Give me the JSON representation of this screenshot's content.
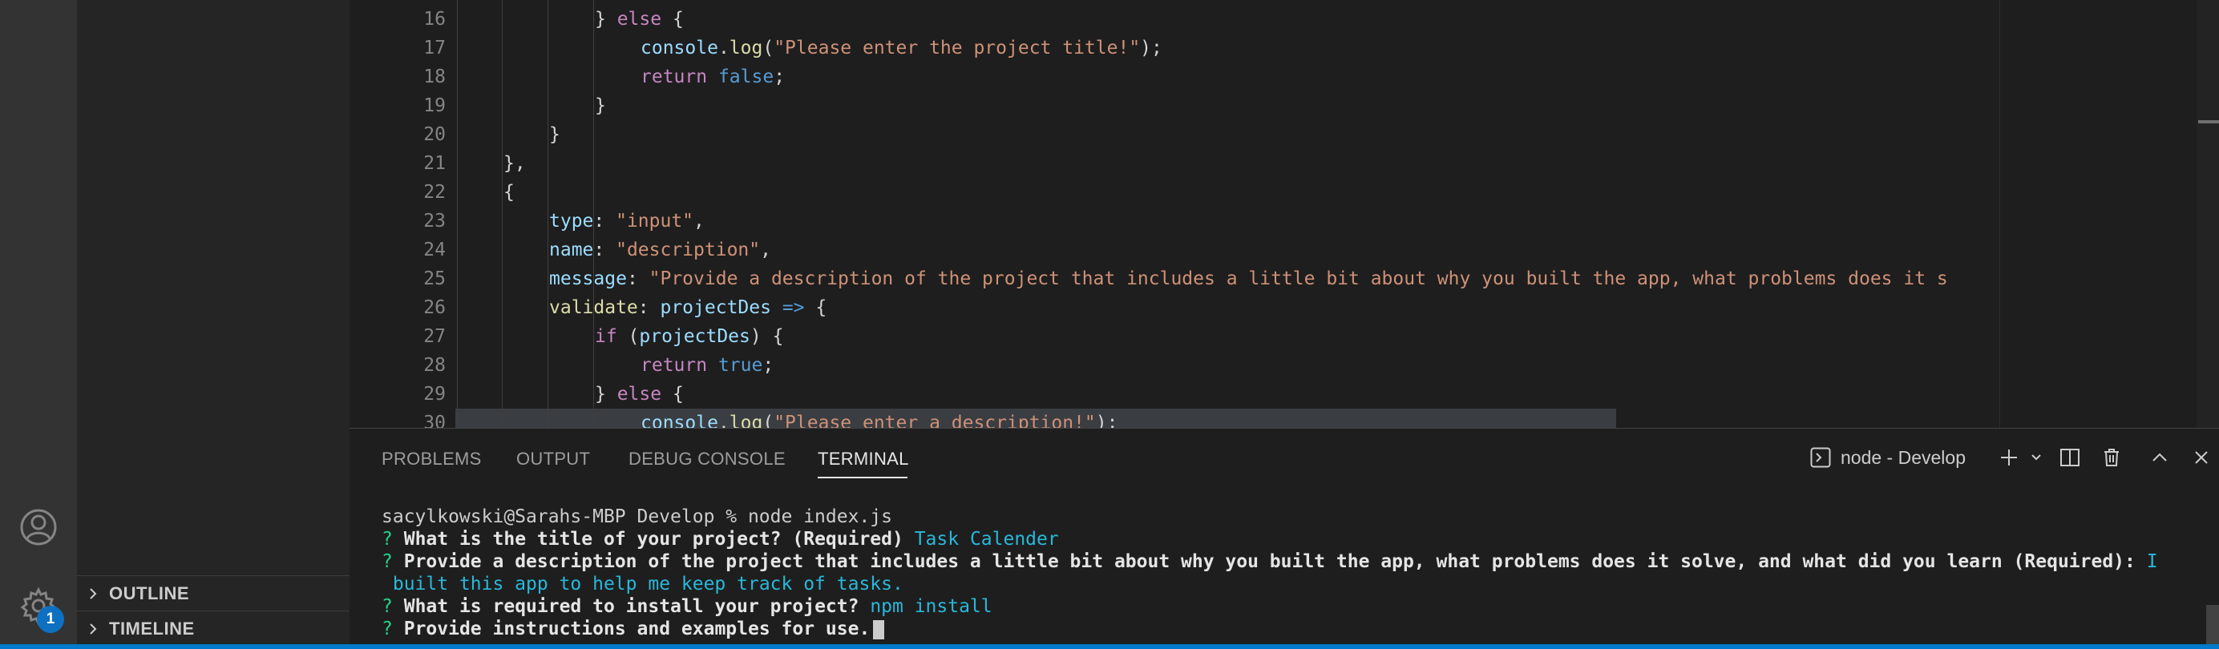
{
  "activity_bar": {
    "manage_badge": "1"
  },
  "side_bar": {
    "sections": [
      {
        "label": "OUTLINE"
      },
      {
        "label": "TIMELINE"
      }
    ]
  },
  "editor": {
    "lines": [
      {
        "n": "16"
      },
      {
        "n": "17"
      },
      {
        "n": "18"
      },
      {
        "n": "19"
      },
      {
        "n": "20"
      },
      {
        "n": "21"
      },
      {
        "n": "22"
      },
      {
        "n": "23"
      },
      {
        "n": "24"
      },
      {
        "n": "25"
      },
      {
        "n": "26"
      },
      {
        "n": "27"
      },
      {
        "n": "28"
      },
      {
        "n": "29"
      },
      {
        "n": "30"
      }
    ],
    "code": {
      "l16_else": "else",
      "l17_console": "console",
      "l17_log": "log",
      "l17_str": "\"Please enter the project title!\"",
      "l18_return": "return",
      "l18_false": "false",
      "l23_key": "type",
      "l23_val": "\"input\"",
      "l24_key": "name",
      "l24_val": "\"description\"",
      "l25_key": "message",
      "l25_val": "\"Provide a description of the project that includes a little bit about why you built the app, what problems does it s",
      "l26_key": "validate",
      "l26_param": "projectDes",
      "l26_arrow": "=>",
      "l27_if": "if",
      "l27_param": "projectDes",
      "l28_return": "return",
      "l28_true": "true",
      "l29_else": "else",
      "l30_console": "console",
      "l30_log": "log",
      "l30_str": "\"Please enter a description!\""
    }
  },
  "panel": {
    "tabs": [
      {
        "label": "PROBLEMS"
      },
      {
        "label": "OUTPUT"
      },
      {
        "label": "DEBUG CONSOLE"
      },
      {
        "label": "TERMINAL",
        "active": true
      }
    ],
    "terminal_name": "node - Develop",
    "terminal": {
      "prompt": "sacylkowski@Sarahs-MBP Develop % node index.js",
      "q_mark": "?",
      "q1": "What is the title of your project? (Required)",
      "a1": "Task Calender",
      "q2": "Provide a description of the project that includes a little bit about why you built the app, what problems does it solve, and what did you learn (Required):",
      "a2_part1": "I",
      "a2_part2": "built this app to help me keep track of tasks.",
      "q3": "What is required to install your project?",
      "a3": "npm install",
      "q4": "Provide instructions and examples for use."
    }
  },
  "colors": {
    "activity_bar": "#333333",
    "side_bar": "#252526",
    "editor_bg": "#1e1e1e",
    "status_bar": "#007acc",
    "badge": "#0e70c0",
    "answer": "#29b8db",
    "question_mark": "#23d18b"
  }
}
